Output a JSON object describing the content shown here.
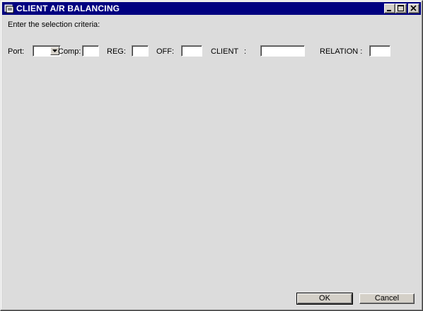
{
  "window": {
    "title": "CLIENT A/R BALANCING",
    "controls": {
      "minimize_icon": "minimize-icon",
      "maximize_icon": "maximize-icon",
      "close_icon": "close-icon"
    }
  },
  "form": {
    "prompt": "Enter the selection criteria:",
    "port": {
      "label": "Port:",
      "value": ""
    },
    "comp": {
      "label": "Comp:",
      "value": ""
    },
    "reg": {
      "label": "REG:",
      "value": ""
    },
    "off": {
      "label": "OFF:",
      "value": ""
    },
    "client": {
      "label": "CLIENT",
      "colon": ":",
      "value": ""
    },
    "relation": {
      "label": "RELATION :",
      "value": ""
    }
  },
  "buttons": {
    "ok": "OK",
    "cancel": "Cancel"
  },
  "colors": {
    "titlebar": "#000080",
    "face": "#d4d0c8",
    "client_area": "#dcdcdc"
  }
}
